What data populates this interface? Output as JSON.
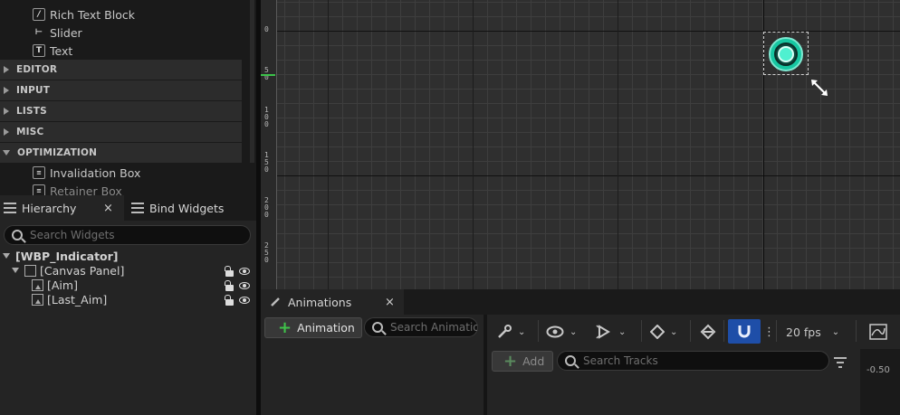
{
  "palette": {
    "items_top": [
      {
        "label": "Rich Text Block",
        "icon": "rich-text-icon"
      },
      {
        "label": "Slider",
        "icon": "slider-icon"
      },
      {
        "label": "Text",
        "icon": "text-icon"
      }
    ],
    "categories": [
      {
        "label": "EDITOR",
        "expanded": false
      },
      {
        "label": "INPUT",
        "expanded": false
      },
      {
        "label": "LISTS",
        "expanded": false
      },
      {
        "label": "MISC",
        "expanded": false
      },
      {
        "label": "OPTIMIZATION",
        "expanded": true
      }
    ],
    "items_bottom": [
      {
        "label": "Invalidation Box",
        "icon": "invalidation-box-icon"
      },
      {
        "label": "Retainer Box",
        "icon": "retainer-box-icon"
      }
    ]
  },
  "hierarchy": {
    "tabs": [
      {
        "label": "Hierarchy",
        "active": true
      },
      {
        "label": "Bind Widgets",
        "active": false
      }
    ],
    "close_glyph": "×",
    "search_placeholder": "Search Widgets",
    "tree": [
      {
        "label": "[WBP_Indicator]"
      },
      {
        "label": "[Canvas Panel]"
      },
      {
        "label": "[Aim]"
      },
      {
        "label": "[Last_Aim]"
      }
    ]
  },
  "designer": {
    "ruler_labels": [
      "0",
      "5\n0",
      "1\n0\n0",
      "1\n5\n0",
      "2\n0\n0",
      "2\n5\n0"
    ],
    "widget_accent": "#17c7a2"
  },
  "animations": {
    "tab_label": "Animations",
    "close_glyph": "×",
    "add_animation_label": "Animation",
    "search_placeholder": "Search Animations"
  },
  "sequencer": {
    "add_label": "Add",
    "search_tracks_placeholder": "Search Tracks",
    "fps_label": "20 fps",
    "timeline_value": "-0.50",
    "snap_color": "#1e4ea8"
  }
}
